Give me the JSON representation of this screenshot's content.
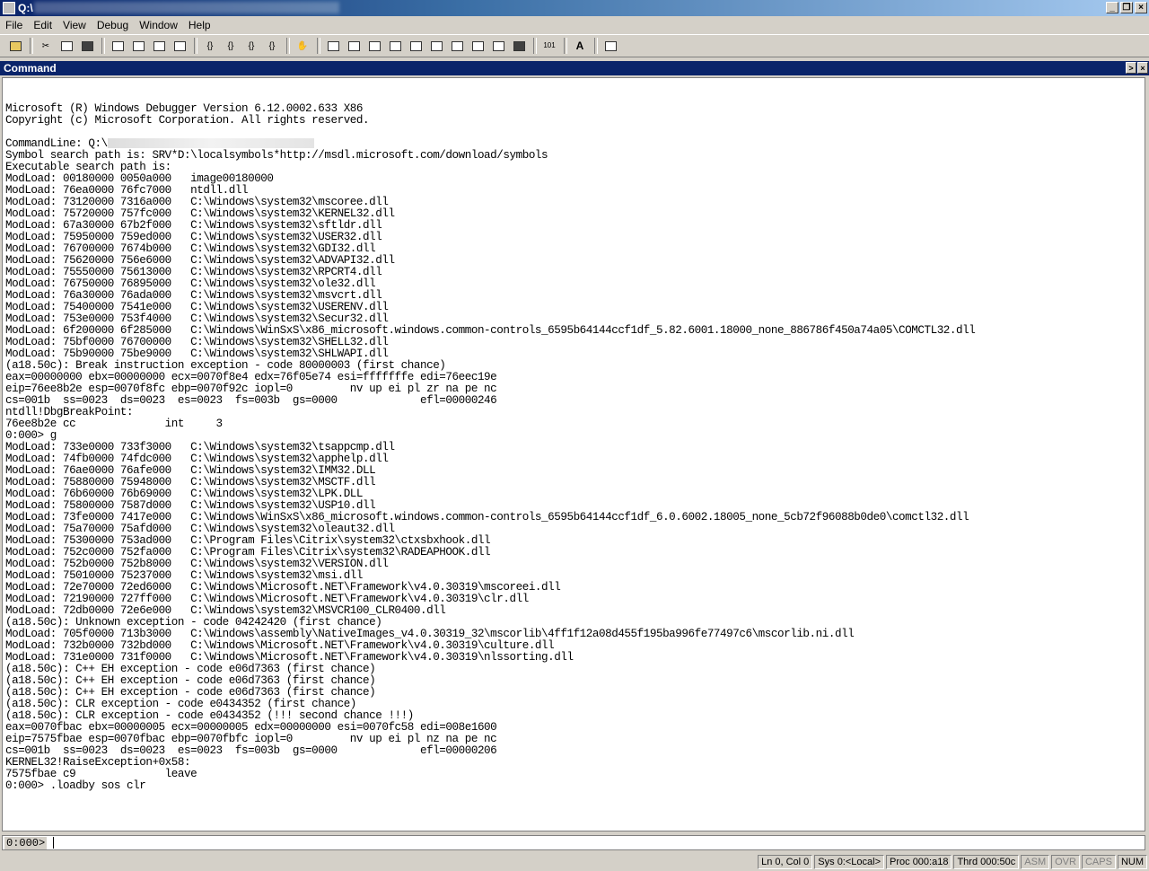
{
  "window": {
    "title": "Q:\\"
  },
  "menu": [
    "File",
    "Edit",
    "View",
    "Debug",
    "Window",
    "Help"
  ],
  "panel": {
    "title": "Command"
  },
  "output_lines": [
    "",
    "Microsoft (R) Windows Debugger Version 6.12.0002.633 X86",
    "Copyright (c) Microsoft Corporation. All rights reserved.",
    "",
    "CommandLine: Q:\\",
    "Symbol search path is: SRV*D:\\localsymbols*http://msdl.microsoft.com/download/symbols",
    "Executable search path is:",
    "ModLoad: 00180000 0050a000   image00180000",
    "ModLoad: 76ea0000 76fc7000   ntdll.dll",
    "ModLoad: 73120000 7316a000   C:\\Windows\\system32\\mscoree.dll",
    "ModLoad: 75720000 757fc000   C:\\Windows\\system32\\KERNEL32.dll",
    "ModLoad: 67a30000 67b2f000   C:\\Windows\\system32\\sftldr.dll",
    "ModLoad: 75950000 759ed000   C:\\Windows\\system32\\USER32.dll",
    "ModLoad: 76700000 7674b000   C:\\Windows\\system32\\GDI32.dll",
    "ModLoad: 75620000 756e6000   C:\\Windows\\system32\\ADVAPI32.dll",
    "ModLoad: 75550000 75613000   C:\\Windows\\system32\\RPCRT4.dll",
    "ModLoad: 76750000 76895000   C:\\Windows\\system32\\ole32.dll",
    "ModLoad: 76a30000 76ada000   C:\\Windows\\system32\\msvcrt.dll",
    "ModLoad: 75400000 7541e000   C:\\Windows\\system32\\USERENV.dll",
    "ModLoad: 753e0000 753f4000   C:\\Windows\\system32\\Secur32.dll",
    "ModLoad: 6f200000 6f285000   C:\\Windows\\WinSxS\\x86_microsoft.windows.common-controls_6595b64144ccf1df_5.82.6001.18000_none_886786f450a74a05\\COMCTL32.dll",
    "ModLoad: 75bf0000 76700000   C:\\Windows\\system32\\SHELL32.dll",
    "ModLoad: 75b90000 75be9000   C:\\Windows\\system32\\SHLWAPI.dll",
    "(a18.50c): Break instruction exception - code 80000003 (first chance)",
    "eax=00000000 ebx=00000000 ecx=0070f8e4 edx=76f05e74 esi=fffffffe edi=76eec19e",
    "eip=76ee8b2e esp=0070f8fc ebp=0070f92c iopl=0         nv up ei pl zr na pe nc",
    "cs=001b  ss=0023  ds=0023  es=0023  fs=003b  gs=0000             efl=00000246",
    "ntdll!DbgBreakPoint:",
    "76ee8b2e cc              int     3",
    "0:000> g",
    "ModLoad: 733e0000 733f3000   C:\\Windows\\system32\\tsappcmp.dll",
    "ModLoad: 74fb0000 74fdc000   C:\\Windows\\system32\\apphelp.dll",
    "ModLoad: 76ae0000 76afe000   C:\\Windows\\system32\\IMM32.DLL",
    "ModLoad: 75880000 75948000   C:\\Windows\\system32\\MSCTF.dll",
    "ModLoad: 76b60000 76b69000   C:\\Windows\\system32\\LPK.DLL",
    "ModLoad: 75800000 7587d000   C:\\Windows\\system32\\USP10.dll",
    "ModLoad: 73fe0000 7417e000   C:\\Windows\\WinSxS\\x86_microsoft.windows.common-controls_6595b64144ccf1df_6.0.6002.18005_none_5cb72f96088b0de0\\comctl32.dll",
    "ModLoad: 75a70000 75afd000   C:\\Windows\\system32\\oleaut32.dll",
    "ModLoad: 75300000 753ad000   C:\\Program Files\\Citrix\\system32\\ctxsbxhook.dll",
    "ModLoad: 752c0000 752fa000   C:\\Program Files\\Citrix\\system32\\RADEAPHOOK.dll",
    "ModLoad: 752b0000 752b8000   C:\\Windows\\system32\\VERSION.dll",
    "ModLoad: 75010000 75237000   C:\\Windows\\system32\\msi.dll",
    "ModLoad: 72e70000 72ed6000   C:\\Windows\\Microsoft.NET\\Framework\\v4.0.30319\\mscoreei.dll",
    "ModLoad: 72190000 727ff000   C:\\Windows\\Microsoft.NET\\Framework\\v4.0.30319\\clr.dll",
    "ModLoad: 72db0000 72e6e000   C:\\Windows\\system32\\MSVCR100_CLR0400.dll",
    "(a18.50c): Unknown exception - code 04242420 (first chance)",
    "ModLoad: 705f0000 713b3000   C:\\Windows\\assembly\\NativeImages_v4.0.30319_32\\mscorlib\\4ff1f12a08d455f195ba996fe77497c6\\mscorlib.ni.dll",
    "ModLoad: 732b0000 732bd000   C:\\Windows\\Microsoft.NET\\Framework\\v4.0.30319\\culture.dll",
    "ModLoad: 731e0000 731f0000   C:\\Windows\\Microsoft.NET\\Framework\\v4.0.30319\\nlssorting.dll",
    "(a18.50c): C++ EH exception - code e06d7363 (first chance)",
    "(a18.50c): C++ EH exception - code e06d7363 (first chance)",
    "(a18.50c): C++ EH exception - code e06d7363 (first chance)",
    "(a18.50c): CLR exception - code e0434352 (first chance)",
    "(a18.50c): CLR exception - code e0434352 (!!! second chance !!!)",
    "eax=0070fbac ebx=00000005 ecx=00000005 edx=00000000 esi=0070fc58 edi=008e1600",
    "eip=7575fbae esp=0070fbac ebp=0070fbfc iopl=0         nv up ei pl nz na pe nc",
    "cs=001b  ss=0023  ds=0023  es=0023  fs=003b  gs=0000             efl=00000206",
    "KERNEL32!RaiseException+0x58:",
    "7575fbae c9              leave",
    "0:000> .loadby sos clr"
  ],
  "command": {
    "prompt": "0:000>",
    "value": ""
  },
  "status": {
    "ln_col": "Ln 0, Col 0",
    "sys": "Sys 0:<Local>",
    "proc": "Proc 000:a18",
    "thrd": "Thrd 000:50c",
    "asm": "ASM",
    "ovr": "OVR",
    "caps": "CAPS",
    "num": "NUM"
  },
  "toolbar_icons": [
    "open-icon",
    "cut-icon",
    "copy-icon",
    "paste-icon",
    "restart-icon",
    "stop-debugging-icon",
    "detach-icon",
    "break-icon",
    "step-into-icon",
    "step-over-icon",
    "step-out-icon",
    "run-to-cursor-icon",
    "breakpoint-hand-icon",
    "command-window-icon",
    "watch-window-icon",
    "locals-window-icon",
    "registers-window-icon",
    "memory-window-icon",
    "call-stack-icon",
    "disassembly-window-icon",
    "scratch-pad-icon",
    "processes-threads-icon",
    "source-mode-icon",
    "hex-display-icon",
    "font-icon",
    "options-icon"
  ]
}
